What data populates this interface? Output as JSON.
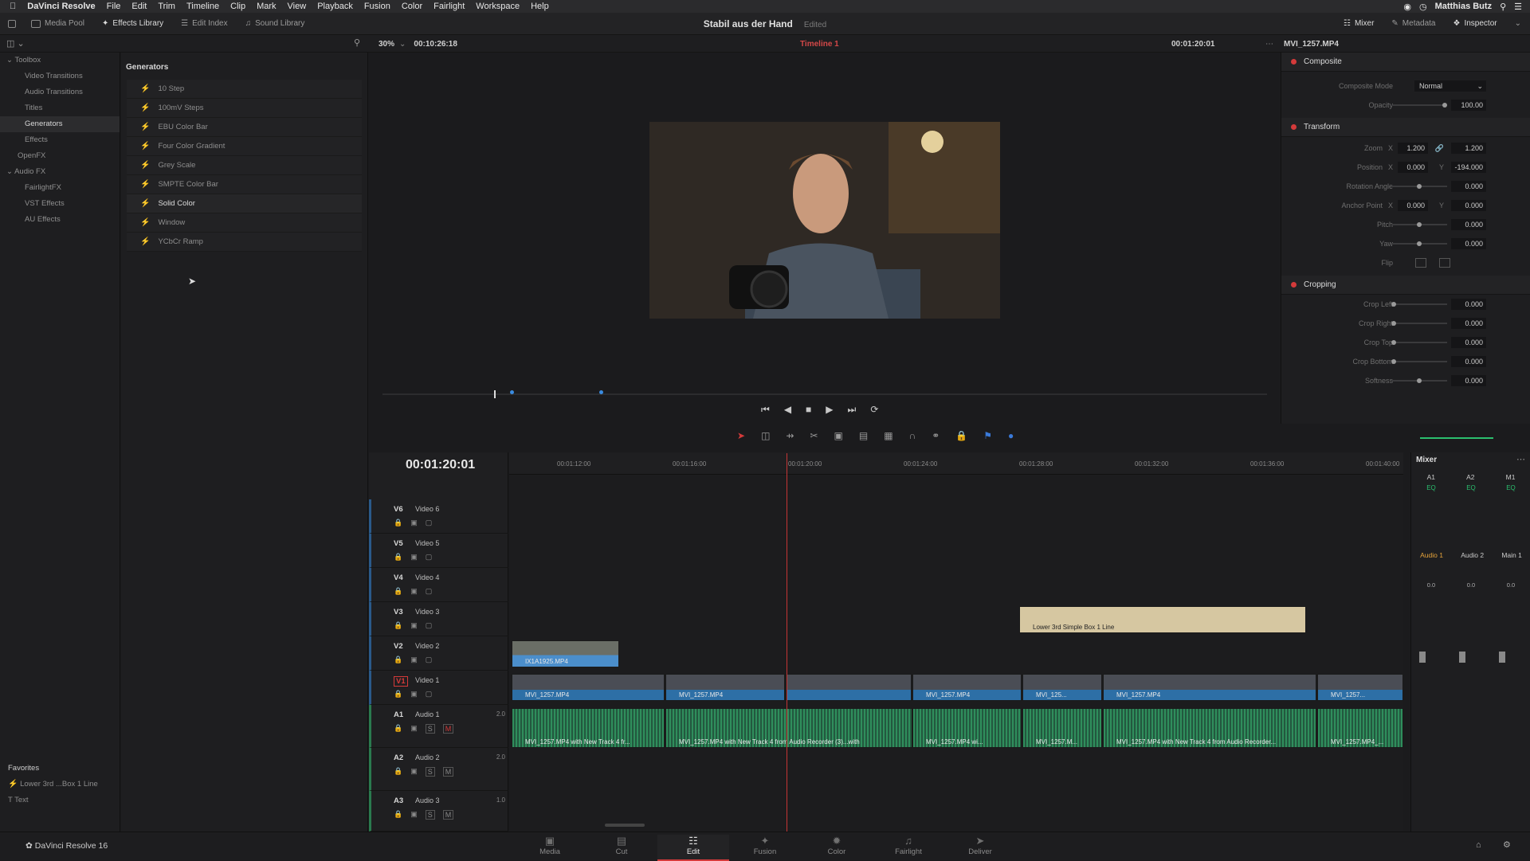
{
  "menubar": {
    "app": "DaVinci Resolve",
    "items": [
      "File",
      "Edit",
      "Trim",
      "Timeline",
      "Clip",
      "Mark",
      "View",
      "Playback",
      "Fusion",
      "Color",
      "Fairlight",
      "Workspace",
      "Help"
    ],
    "user": "Matthias Butz"
  },
  "toolbar": {
    "media_pool": "Media Pool",
    "effects_library": "Effects Library",
    "edit_index": "Edit Index",
    "sound_library": "Sound Library",
    "project_title": "Stabil aus der Hand",
    "project_status": "Edited",
    "mixer": "Mixer",
    "metadata": "Metadata",
    "inspector": "Inspector"
  },
  "viewer_bar": {
    "zoom": "30%",
    "src_tc": "00:10:26:18",
    "timeline": "Timeline 1",
    "rec_tc": "00:01:20:01",
    "clip_name": "MVI_1257.MP4"
  },
  "toolbox": {
    "items": [
      {
        "label": "Toolbox",
        "level": 0
      },
      {
        "label": "Video Transitions",
        "level": 1
      },
      {
        "label": "Audio Transitions",
        "level": 1
      },
      {
        "label": "Titles",
        "level": 1
      },
      {
        "label": "Generators",
        "level": 1,
        "selected": true
      },
      {
        "label": "Effects",
        "level": 1
      },
      {
        "label": "OpenFX",
        "level": 0
      },
      {
        "label": "Audio FX",
        "level": 0
      },
      {
        "label": "FairlightFX",
        "level": 1
      },
      {
        "label": "VST Effects",
        "level": 1
      },
      {
        "label": "AU Effects",
        "level": 1
      }
    ]
  },
  "generators": {
    "title": "Generators",
    "items": [
      "10 Step",
      "100mV Steps",
      "EBU Color Bar",
      "Four Color Gradient",
      "Grey Scale",
      "SMPTE Color Bar",
      "Solid Color",
      "Window",
      "YCbCr Ramp"
    ],
    "selected": "Solid Color"
  },
  "favorites": {
    "title": "Favorites",
    "items": [
      "Lower 3rd ...Box 1 Line",
      "Text"
    ]
  },
  "inspector": {
    "composite": {
      "title": "Composite",
      "mode_label": "Composite Mode",
      "mode_value": "Normal",
      "opacity_label": "Opacity",
      "opacity_value": "100.00"
    },
    "transform": {
      "title": "Transform",
      "zoom_label": "Zoom",
      "zoom_x": "1.200",
      "zoom_y": "1.200",
      "position_label": "Position",
      "position_x": "0.000",
      "position_y": "-194.000",
      "rotation_label": "Rotation Angle",
      "rotation_value": "0.000",
      "anchor_label": "Anchor Point",
      "anchor_x": "0.000",
      "anchor_y": "0.000",
      "pitch_label": "Pitch",
      "pitch_value": "0.000",
      "yaw_label": "Yaw",
      "yaw_value": "0.000",
      "flip_label": "Flip",
      "x": "X",
      "y": "Y"
    },
    "cropping": {
      "title": "Cropping",
      "left_label": "Crop Left",
      "left_value": "0.000",
      "right_label": "Crop Right",
      "right_value": "0.000",
      "top_label": "Crop Top",
      "top_value": "0.000",
      "bottom_label": "Crop Bottom",
      "bottom_value": "0.000",
      "softness_label": "Softness",
      "softness_value": "0.000"
    }
  },
  "timeline": {
    "timecode": "00:01:20:01",
    "ruler": [
      "00:01:12:00",
      "00:01:16:00",
      "00:01:20:00",
      "00:01:24:00",
      "00:01:28:00",
      "00:01:32:00",
      "00:01:36:00",
      "00:01:40:00"
    ],
    "tracks": [
      {
        "id": "V6",
        "name": "Video 6"
      },
      {
        "id": "V5",
        "name": "Video 5"
      },
      {
        "id": "V4",
        "name": "Video 4"
      },
      {
        "id": "V3",
        "name": "Video 3"
      },
      {
        "id": "V2",
        "name": "Video 2"
      },
      {
        "id": "V1",
        "name": "Video 1"
      },
      {
        "id": "A1",
        "name": "Audio 1",
        "ch": "2.0"
      },
      {
        "id": "A2",
        "name": "Audio 2",
        "ch": "2.0"
      },
      {
        "id": "A3",
        "name": "Audio 3",
        "ch": "1.0"
      }
    ],
    "clips": {
      "v2": "IX1A1925.MP4",
      "title": "Lower 3rd Simple Box 1 Line",
      "v1": [
        "MVI_1257.MP4",
        "MVI_1257.MP4",
        "MVI_1257.MP4",
        "MVI_125...",
        "MVI_1257.MP4",
        "MVI_1257..."
      ],
      "a1": [
        "MVI_1257.MP4 with New Track 4 fr...",
        "MVI_1257.MP4 with New Track 4 from Audio Recorder (3)...with",
        "MVI_1257.MP4 wi...",
        "MVI_1257.M...",
        "MVI_1257.MP4 with New Track 4 from Audio Recorder...",
        "MVI_1257.MP4_..."
      ]
    }
  },
  "mixer": {
    "title": "Mixer",
    "buses": [
      "A1",
      "A2",
      "M1"
    ],
    "channel_names": [
      "Audio 1",
      "Audio 2",
      "Main 1"
    ],
    "eq": "EQ",
    "gain": "0.0"
  },
  "pages": {
    "product": "DaVinci Resolve 16",
    "items": [
      "Media",
      "Cut",
      "Edit",
      "Fusion",
      "Color",
      "Fairlight",
      "Deliver"
    ],
    "active": "Edit"
  },
  "colors": {
    "accent": "#d43a3a",
    "clip_blue": "#2d6fa6",
    "audio_green": "#2f8e5c",
    "title_clip": "#d6c7a1"
  }
}
